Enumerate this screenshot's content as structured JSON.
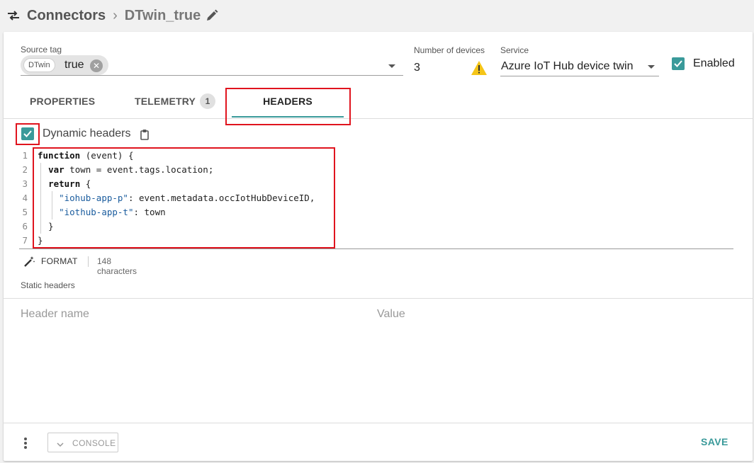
{
  "breadcrumb": {
    "root": "Connectors",
    "separator": "›",
    "current": "DTwin_true"
  },
  "source_tag": {
    "label": "Source tag",
    "chip_tag": "DTwin",
    "chip_value": "true"
  },
  "devices": {
    "label": "Number of devices",
    "value": "3"
  },
  "service": {
    "label": "Service",
    "value": "Azure IoT Hub device twin"
  },
  "enabled": {
    "label": "Enabled",
    "checked": true
  },
  "tabs": [
    {
      "label": "PROPERTIES"
    },
    {
      "label": "TELEMETRY",
      "badge": "1"
    },
    {
      "label": "HEADERS",
      "active": true
    }
  ],
  "dynamic_headers": {
    "label": "Dynamic headers",
    "checked": true
  },
  "code": {
    "line_numbers": [
      "1",
      "2",
      "3",
      "4",
      "5",
      "6",
      "7"
    ],
    "lines": [
      "function (event) {",
      "  var town = event.tags.location;",
      "  return {",
      "    \"iohub-app-p\": event.metadata.occIotHubDeviceID,",
      "    \"iothub-app-t\": town",
      "  }",
      "}"
    ]
  },
  "format": {
    "label": "FORMAT",
    "count": "148 characters"
  },
  "static_headers": {
    "label": "Static headers",
    "name_placeholder": "Header name",
    "value_placeholder": "Value"
  },
  "footer": {
    "console_label": "CONSOLE",
    "save_label": "SAVE"
  },
  "colors": {
    "accent": "#3a9a9a",
    "highlight": "#e0141e",
    "warning": "#f5c518"
  }
}
